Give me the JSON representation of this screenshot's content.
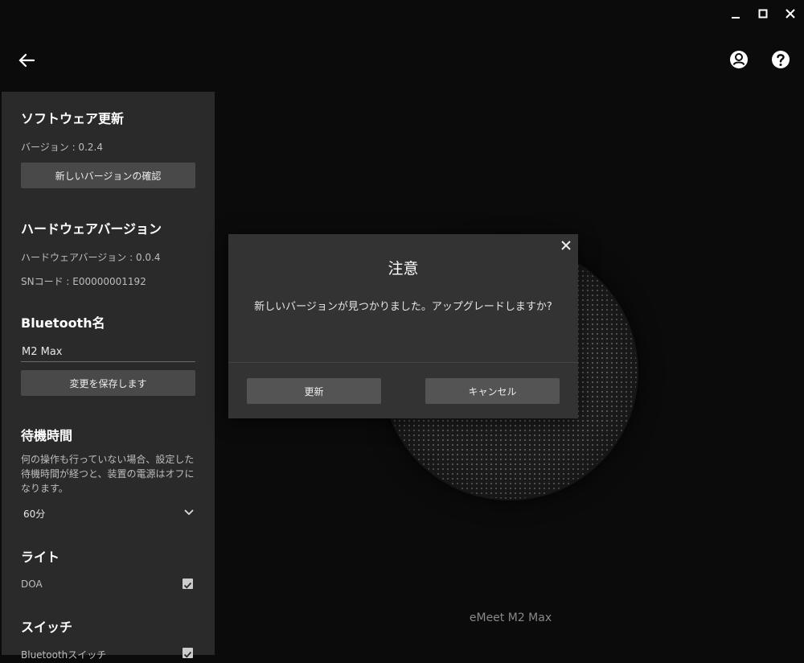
{
  "window": {
    "minimize_icon": "minimize-icon",
    "maximize_icon": "maximize-icon",
    "close_icon": "close-icon"
  },
  "toolbar": {
    "back_icon": "arrow-left-icon",
    "account_icon": "user-circle-icon",
    "help_icon": "help-circle-icon"
  },
  "sidebar": {
    "software_update": {
      "title": "ソフトウェア更新",
      "version": "バージョン : 0.2.4",
      "check_button": "新しいバージョンの確認"
    },
    "hardware": {
      "title": "ハードウェアバージョン",
      "version": "ハードウェアバージョン : 0.0.4",
      "sn": "SNコード : E00000001192"
    },
    "bluetooth_name": {
      "title": "Bluetooth名",
      "value": "M2 Max",
      "save_button": "変更を保存します"
    },
    "standby": {
      "title": "待機時間",
      "description": "何の操作も行っていない場合、設定した待機時間が経つと、装置の電源はオフになります。",
      "selected": "60分"
    },
    "light": {
      "title": "ライト",
      "doa_label": "DOA",
      "doa_checked": true
    },
    "switch": {
      "title": "スイッチ",
      "bluetooth_label": "Bluetoothスイッチ",
      "bluetooth_checked": true
    }
  },
  "device": {
    "name": "eMeet M2 Max"
  },
  "dialog": {
    "title": "注意",
    "message": "新しいバージョンが見つかりました。アップグレードしますか?",
    "update_button": "更新",
    "cancel_button": "キャンセル"
  },
  "colors": {
    "background": "#0b0b0b",
    "panel": "#2a2a2a",
    "dialog": "#333333",
    "button": "#494949"
  }
}
